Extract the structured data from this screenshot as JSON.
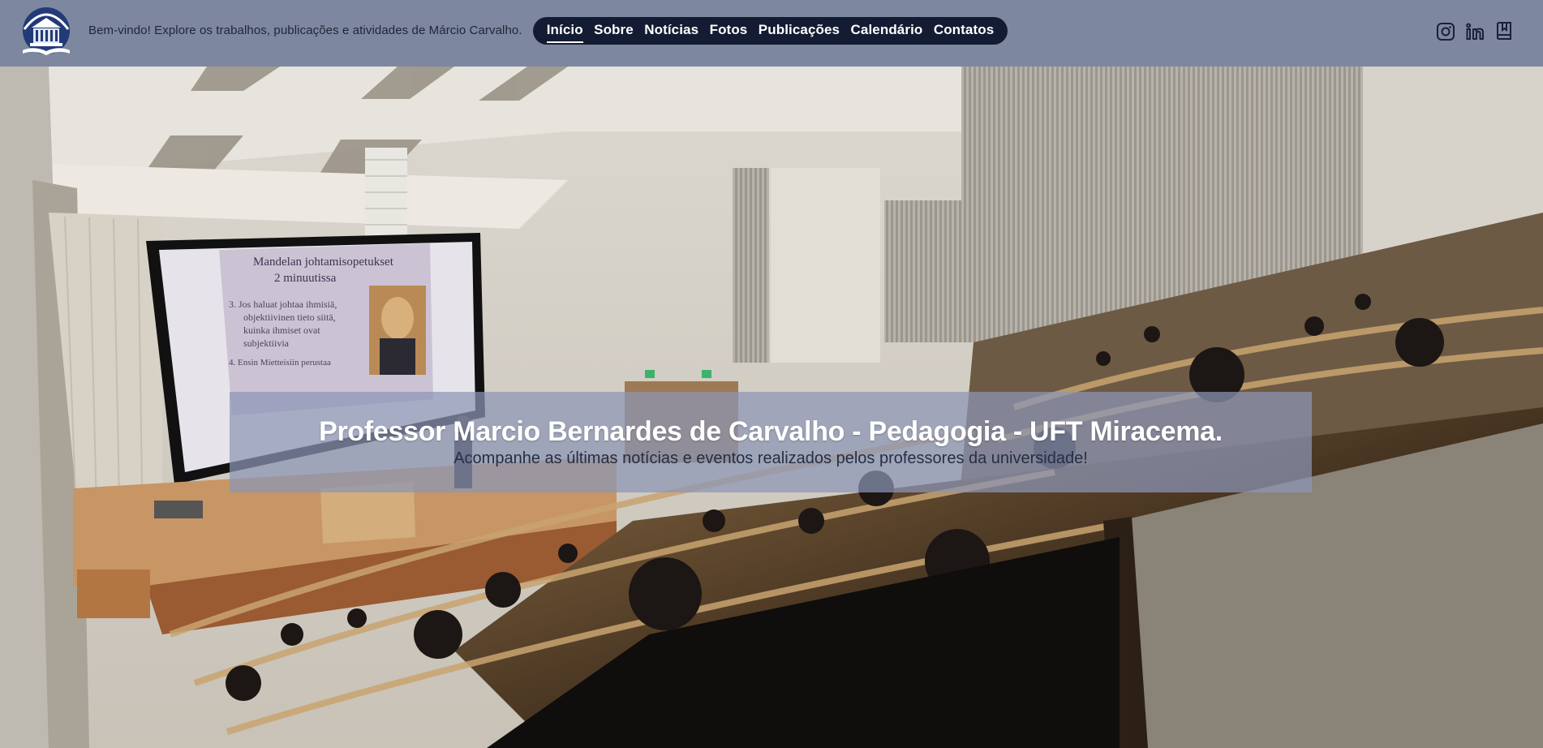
{
  "header": {
    "tagline": "Bem-vindo! Explore os trabalhos, publicações e atividades de Márcio Carvalho.",
    "logo_icon": "university-building-logo",
    "nav": [
      {
        "label": "Início",
        "active": true
      },
      {
        "label": "Sobre"
      },
      {
        "label": "Notícias"
      },
      {
        "label": "Fotos"
      },
      {
        "label": "Publicações"
      },
      {
        "label": "Calendário"
      },
      {
        "label": "Contatos"
      }
    ],
    "social": [
      "instagram-icon",
      "linkedin-icon",
      "lattes-bookmark-icon"
    ]
  },
  "hero": {
    "title": "Professor Marcio Bernardes de Carvalho - Pedagogia - UFT Miracema.",
    "subtitle": "Acompanhe as últimas notícias e eventos realizados pelos professores da universidade!",
    "projector_slide": {
      "heading_line1": "Mandelan johtamisopetukset",
      "heading_line2": "2 minuutissa",
      "item3_line1": "3. Jos haluat johtaa ihmisiä,",
      "item3_line2": "objektiivinen tieto siitä,",
      "item3_line3": "kuinka ihmiset ovat",
      "item3_line4": "subjektiivia",
      "item4": "4. Ensin Mietteisiin perustaa"
    }
  },
  "colors": {
    "header_bg": "#7d879f",
    "nav_bg": "#141c33",
    "hero_overlay": "#8c96b6",
    "text_dark": "#1e2638"
  }
}
